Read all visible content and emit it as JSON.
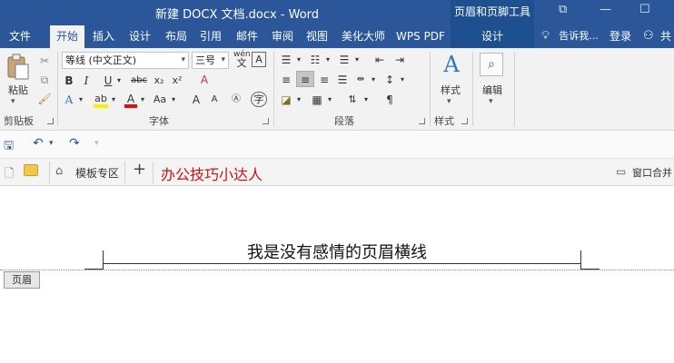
{
  "window": {
    "title": "新建 DOCX 文档.docx - Word",
    "context_group": "页眉和页脚工具",
    "ctl_restore": "⧉",
    "ctl_min": "—",
    "ctl_max": "☐"
  },
  "tabs": {
    "file": "文件",
    "home": "开始",
    "insert": "插入",
    "design": "设计",
    "layout": "布局",
    "references": "引用",
    "mailings": "邮件",
    "review": "审阅",
    "view": "视图",
    "meihua": "美化大师",
    "wps": "WPS PDF",
    "ctx_design": "设计",
    "tellme": "告诉我...",
    "login": "登录",
    "share": "共"
  },
  "ribbon": {
    "clipboard": {
      "paste": "粘贴",
      "label": "剪贴板"
    },
    "font": {
      "font_name": "等线 (中文正文)",
      "font_size": "三号",
      "wen": "wén",
      "label": "字体",
      "bold": "B",
      "italic": "I",
      "underline": "U",
      "strike": "abc",
      "sub": "x₂",
      "sup": "x²",
      "grow": "A",
      "shrink": "A",
      "case": "Aa",
      "clear": "A",
      "color": "A",
      "highlight": "ab",
      "effects": "A",
      "char_border": "A",
      "char_circle": "字"
    },
    "paragraph": {
      "label": "段落"
    },
    "styles": {
      "label": "样式",
      "btn": "样式"
    },
    "editing": {
      "btn": "编辑"
    }
  },
  "qat": {
    "save": "save",
    "undo": "undo",
    "redo": "redo"
  },
  "doc_tabs": {
    "template": "模板专区",
    "add": "+",
    "site": "办公技巧小达人",
    "window_merge": "窗口合并"
  },
  "document": {
    "header_text": "我是没有感情的页眉横线",
    "header_badge": "页眉"
  },
  "colors": {
    "word_blue": "#2b579a",
    "context_blue": "#1e4f8f",
    "site_red": "#cc1111",
    "font_color_red": "#e01010",
    "highlight_yellow": "#ffee00"
  }
}
